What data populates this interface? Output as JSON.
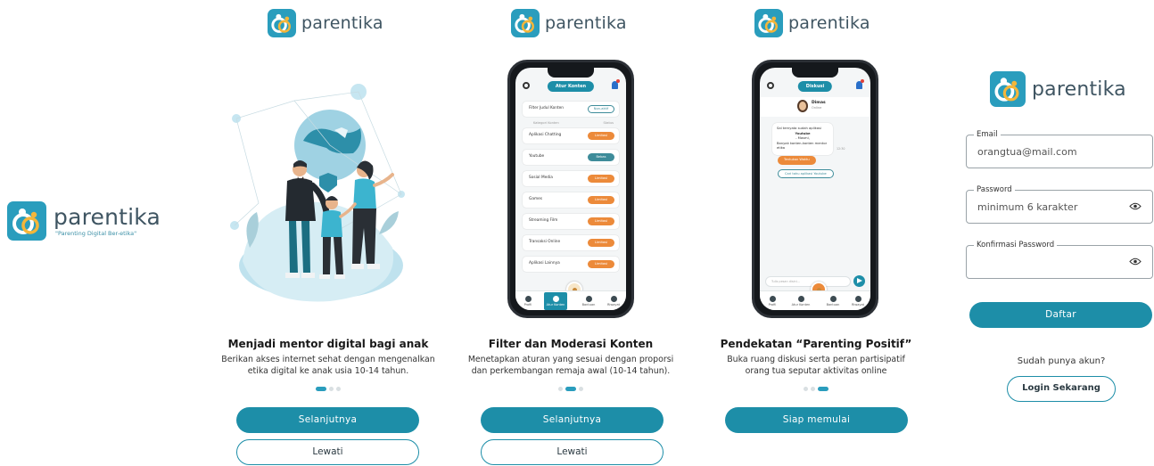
{
  "brand": {
    "name": "parentika",
    "tagline": "\"Parenting Digital Ber-etika\"",
    "colors": {
      "primary": "#1d8ea8",
      "logo_bg": "#2a9dbd",
      "accent_orange": "#ec8a3a",
      "accent_yellow": "#f4b63a"
    }
  },
  "onboarding": [
    {
      "title": "Menjadi mentor digital bagi anak",
      "description_lines": [
        "Berikan akses internet sehat dengan mengenalkan",
        "etika digital ke anak usia 10-14 tahun."
      ],
      "primary_button": "Selanjutnya",
      "secondary_button": "Lewati",
      "active_dot": 1
    },
    {
      "title": "Filter dan Moderasi Konten",
      "description_lines": [
        "Menetapkan aturan yang sesuai dengan proporsi",
        "dan perkembangan remaja awal (10-14 tahun)."
      ],
      "primary_button": "Selanjutnya",
      "secondary_button": "Lewati",
      "active_dot": 2
    },
    {
      "title": "Pendekatan “Parenting Positif”",
      "description_lines": [
        "Buka ruang diskusi serta peran partisipatif",
        "orang tua seputar aktivitas online"
      ],
      "primary_button": "Siap memulai",
      "active_dot": 3
    }
  ],
  "filter_screen": {
    "title": "Atur Konten",
    "search_row": {
      "label": "Filter Judul Konten",
      "toggle": "Non-aktif"
    },
    "column_headers": [
      "Kategori Konten",
      "Status"
    ],
    "items": [
      {
        "label": "Aplikasi Chatting",
        "status": "Limitasi"
      },
      {
        "label": "Youtube",
        "status": "Bebas"
      },
      {
        "label": "Sosial Media",
        "status": "Limitasi"
      },
      {
        "label": "Games",
        "status": "Limitasi"
      },
      {
        "label": "Streaming Film",
        "status": "Limitasi"
      },
      {
        "label": "Transaksi Online",
        "status": "Limitasi"
      },
      {
        "label": "Aplikasi Lainnya",
        "status": "Limitasi"
      }
    ],
    "fab_label": "Diskusi",
    "nav": [
      "Profil",
      "Atur Konten",
      "Bantuan",
      "Riwayat"
    ]
  },
  "chat_screen": {
    "title": "Diskusi",
    "contact_name": "Dimas",
    "contact_status": "Online",
    "message": [
      "Sal ternyata sudah aplikasi",
      "Youtube",
      "- Masmi,",
      "Banyak konten-konten mentor etika"
    ],
    "time": "12:30",
    "chips": [
      "Tentukan Waktu",
      "Cari tahu aplikasi Youtube"
    ],
    "input_placeholder": "Tulis pesan disini...",
    "fab_label": "Diskusi",
    "nav": [
      "Profil",
      "Atur Konten",
      "Bantuan",
      "Riwayat"
    ]
  },
  "register": {
    "email_label": "Email",
    "email_value": "orangtua@mail.com",
    "password_label": "Password",
    "password_placeholder": "minimum 6 karakter",
    "confirm_label": "Konfirmasi Password",
    "confirm_placeholder": "",
    "submit_button": "Daftar",
    "have_account_text": "Sudah punya akun?",
    "login_button": "Login Sekarang"
  }
}
